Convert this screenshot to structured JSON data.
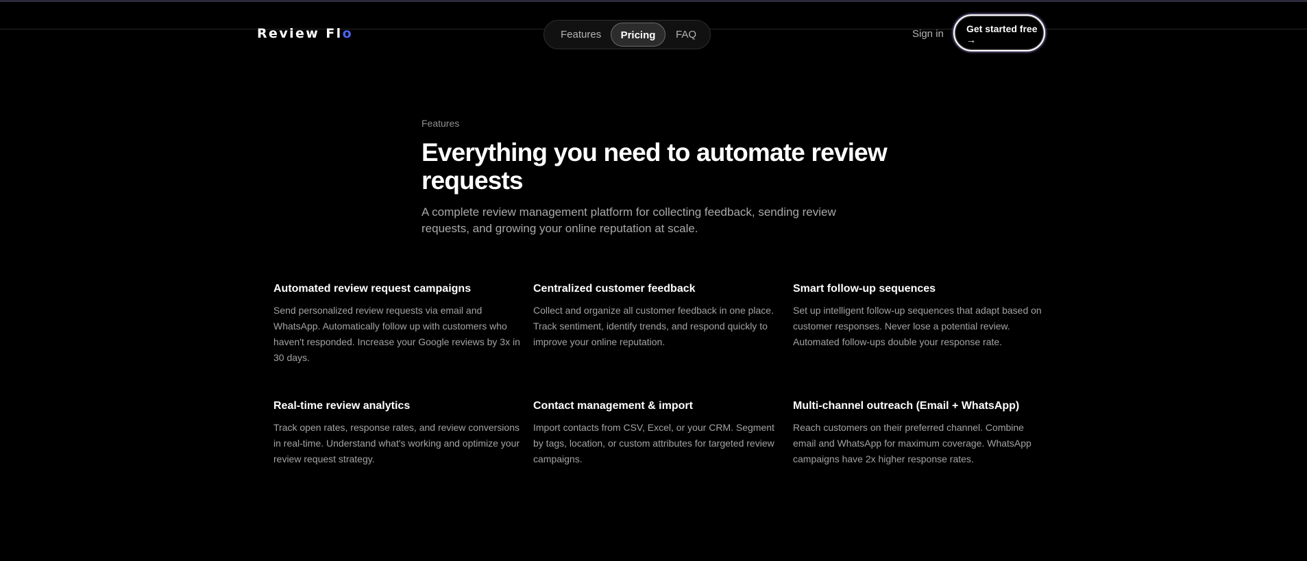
{
  "brand": {
    "name": "Review Fl",
    "name_accent": "o",
    "accent_color": "#4a63f0"
  },
  "nav": {
    "items": [
      {
        "label": "Features"
      },
      {
        "label": "Pricing",
        "active": true
      },
      {
        "label": "FAQ"
      }
    ],
    "sign_in": "Sign in",
    "cta_label": "Get started free",
    "cta_icon": "arrow-right-icon",
    "cta_arrow": "→"
  },
  "section": {
    "eyebrow": "Features",
    "title": "Everything you need to automate review requests",
    "subtitle": "A complete review management platform for collecting feedback, sending review requests, and growing your online reputation at scale."
  },
  "features": [
    {
      "title": "Automated review request campaigns",
      "description": "Send personalized review requests via email and WhatsApp. Automatically follow up with customers who haven't responded. Increase your Google reviews by 3x in 30 days."
    },
    {
      "title": "Centralized customer feedback",
      "description": "Collect and organize all customer feedback in one place. Track sentiment, identify trends, and respond quickly to improve your online reputation."
    },
    {
      "title": "Smart follow-up sequences",
      "description": "Set up intelligent follow-up sequences that adapt based on customer responses. Never lose a potential review. Automated follow-ups double your response rate."
    },
    {
      "title": "Real-time review analytics",
      "description": "Track open rates, response rates, and review conversions in real-time. Understand what's working and optimize your review request strategy."
    },
    {
      "title": "Contact management & import",
      "description": "Import contacts from CSV, Excel, or your CRM. Segment by tags, location, or custom attributes for targeted review campaigns."
    },
    {
      "title": "Multi-channel outreach (Email + WhatsApp)",
      "description": "Reach customers on their preferred channel. Combine email and WhatsApp for maximum coverage. WhatsApp campaigns have 2x higher response rates."
    }
  ]
}
